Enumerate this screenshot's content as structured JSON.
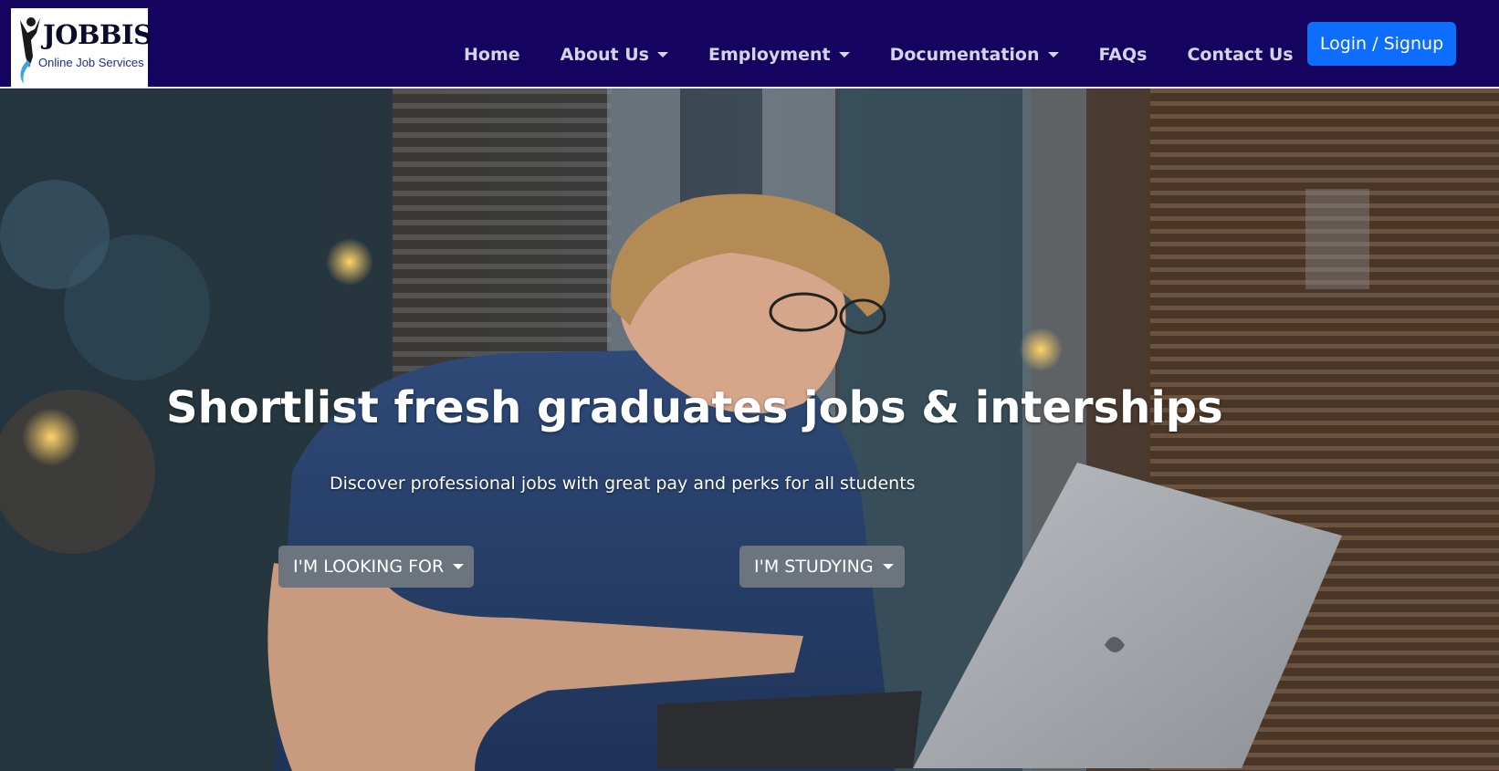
{
  "brand": {
    "name": "JOBBIS",
    "tagline": "Online Job Services"
  },
  "nav": {
    "items": [
      {
        "label": "Home",
        "dropdown": false
      },
      {
        "label": "About Us",
        "dropdown": true
      },
      {
        "label": "Employment",
        "dropdown": true
      },
      {
        "label": "Documentation",
        "dropdown": true
      },
      {
        "label": "FAQs",
        "dropdown": false
      },
      {
        "label": "Contact Us",
        "dropdown": false
      }
    ],
    "login_label": "Login / Signup"
  },
  "hero": {
    "title": "Shortlist fresh graduates jobs & interships",
    "subtitle": "Discover professional jobs with great pay and perks for all students",
    "looking_for_label": "I'M LOOKING FOR",
    "studying_label": "I'M STUDYING"
  },
  "colors": {
    "navbar_bg": "#140460",
    "primary_button": "#0d6efd",
    "secondary_button": "#6c757d"
  }
}
